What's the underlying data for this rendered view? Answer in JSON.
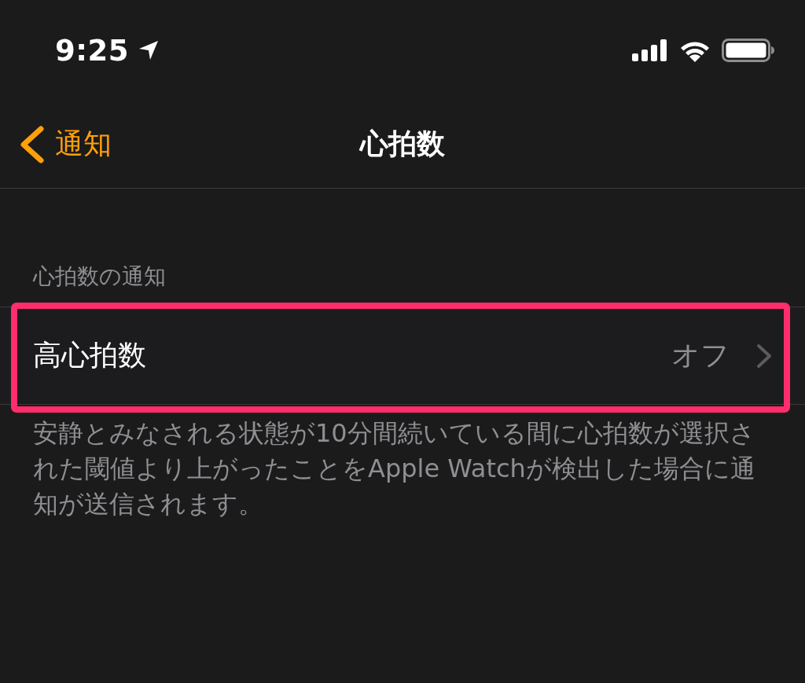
{
  "status_bar": {
    "time": "9:25"
  },
  "nav_bar": {
    "back_label": "通知",
    "title": "心拍数"
  },
  "section": {
    "header": "心拍数の通知",
    "rows": [
      {
        "label": "高心拍数",
        "value": "オフ",
        "highlighted": true
      }
    ],
    "footer": "安静とみなされる状態が10分間続いている間に心拍数が選択された閾値より上がったことをApple Watchが検出した場合に通知が送信されます。"
  }
}
